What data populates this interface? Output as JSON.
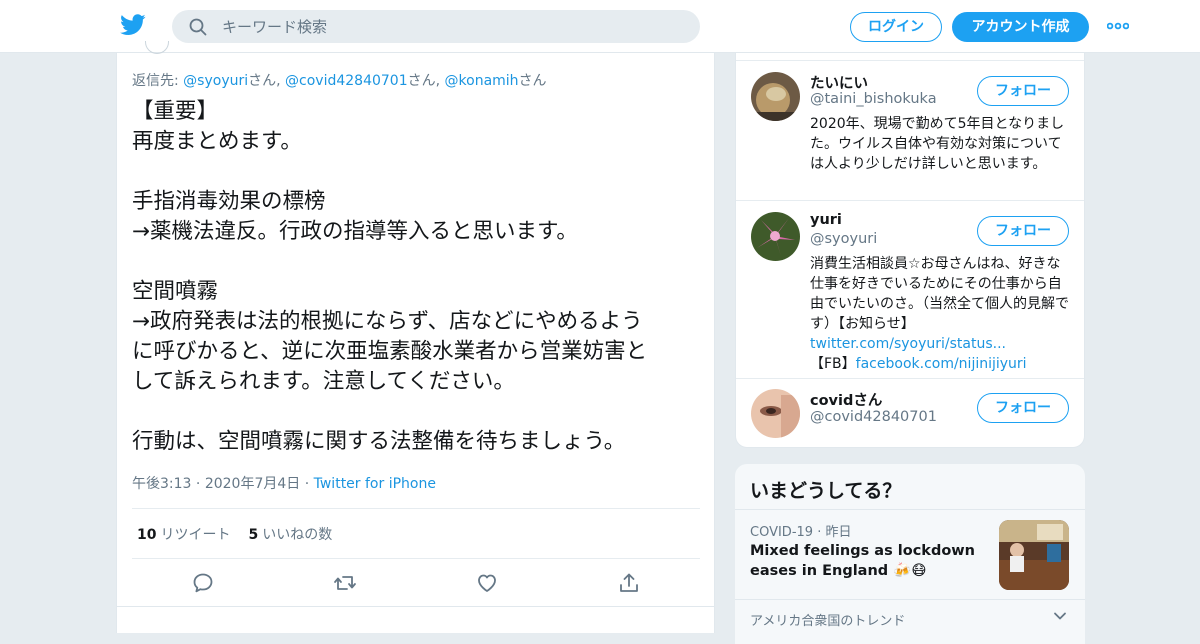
{
  "header": {
    "search_placeholder": "キーワード検索",
    "login_label": "ログイン",
    "signup_label": "アカウント作成",
    "brand_color": "#1da1f2"
  },
  "tweet": {
    "reply_prefix": "返信先: ",
    "mentions": [
      {
        "handle": "@syoyuri",
        "suffix": "さん, "
      },
      {
        "handle": "@covid42840701",
        "suffix": "さん, "
      },
      {
        "handle": "@konamih",
        "suffix": "さん"
      }
    ],
    "body": "【重要】\n再度まとめます。\n\n手指消毒効果の標榜\n→薬機法違反。行政の指導等入ると思います。\n\n空間噴霧\n→政府発表は法的根拠にならず、店などにやめるよう\nに呼びかると、逆に次亜塩素酸水業者から営業妨害と\nして訴えられます。注意してください。\n\n行動は、空間噴霧に関する法整備を待ちましょう。",
    "time": "午後3:13",
    "date": "2020年7月4日",
    "source": "Twitter for iPhone",
    "retweet_count": "10",
    "retweet_label": "リツイート",
    "like_count": "5",
    "like_label": "いいねの数",
    "actions": [
      "reply-icon",
      "retweet-icon",
      "like-icon",
      "share-icon"
    ]
  },
  "who_to_follow": [
    {
      "name": "たいにい",
      "handle": "@taini_bishokuka",
      "bio": "2020年、現場で勤めて5年目となりました。ウイルス自体や有効な対策については人より少しだけ詳しいと思います。",
      "follow_label": "フォロー"
    },
    {
      "name": "yuri",
      "handle": "@syoyuri",
      "bio": "消費生活相談員☆お母さんはね、好きな仕事を好きでいるためにその仕事から自由でいたいのさ。（当然全て個人的見解です）【お知らせ】",
      "bio_link1": "twitter.com/syoyuri/status...",
      "bio_fb_prefix": "【FB】",
      "bio_link2": "facebook.com/nijinijiyuri",
      "follow_label": "フォロー"
    },
    {
      "name": "covidさん",
      "handle": "@covid42840701",
      "follow_label": "フォロー"
    }
  ],
  "trends": {
    "title": "いまどうしてる？",
    "category": "COVID-19",
    "when": "昨日",
    "headline": "Mixed feelings as lockdown eases in England 🍻😷",
    "location_label": "アメリカ合衆国のトレンド"
  }
}
